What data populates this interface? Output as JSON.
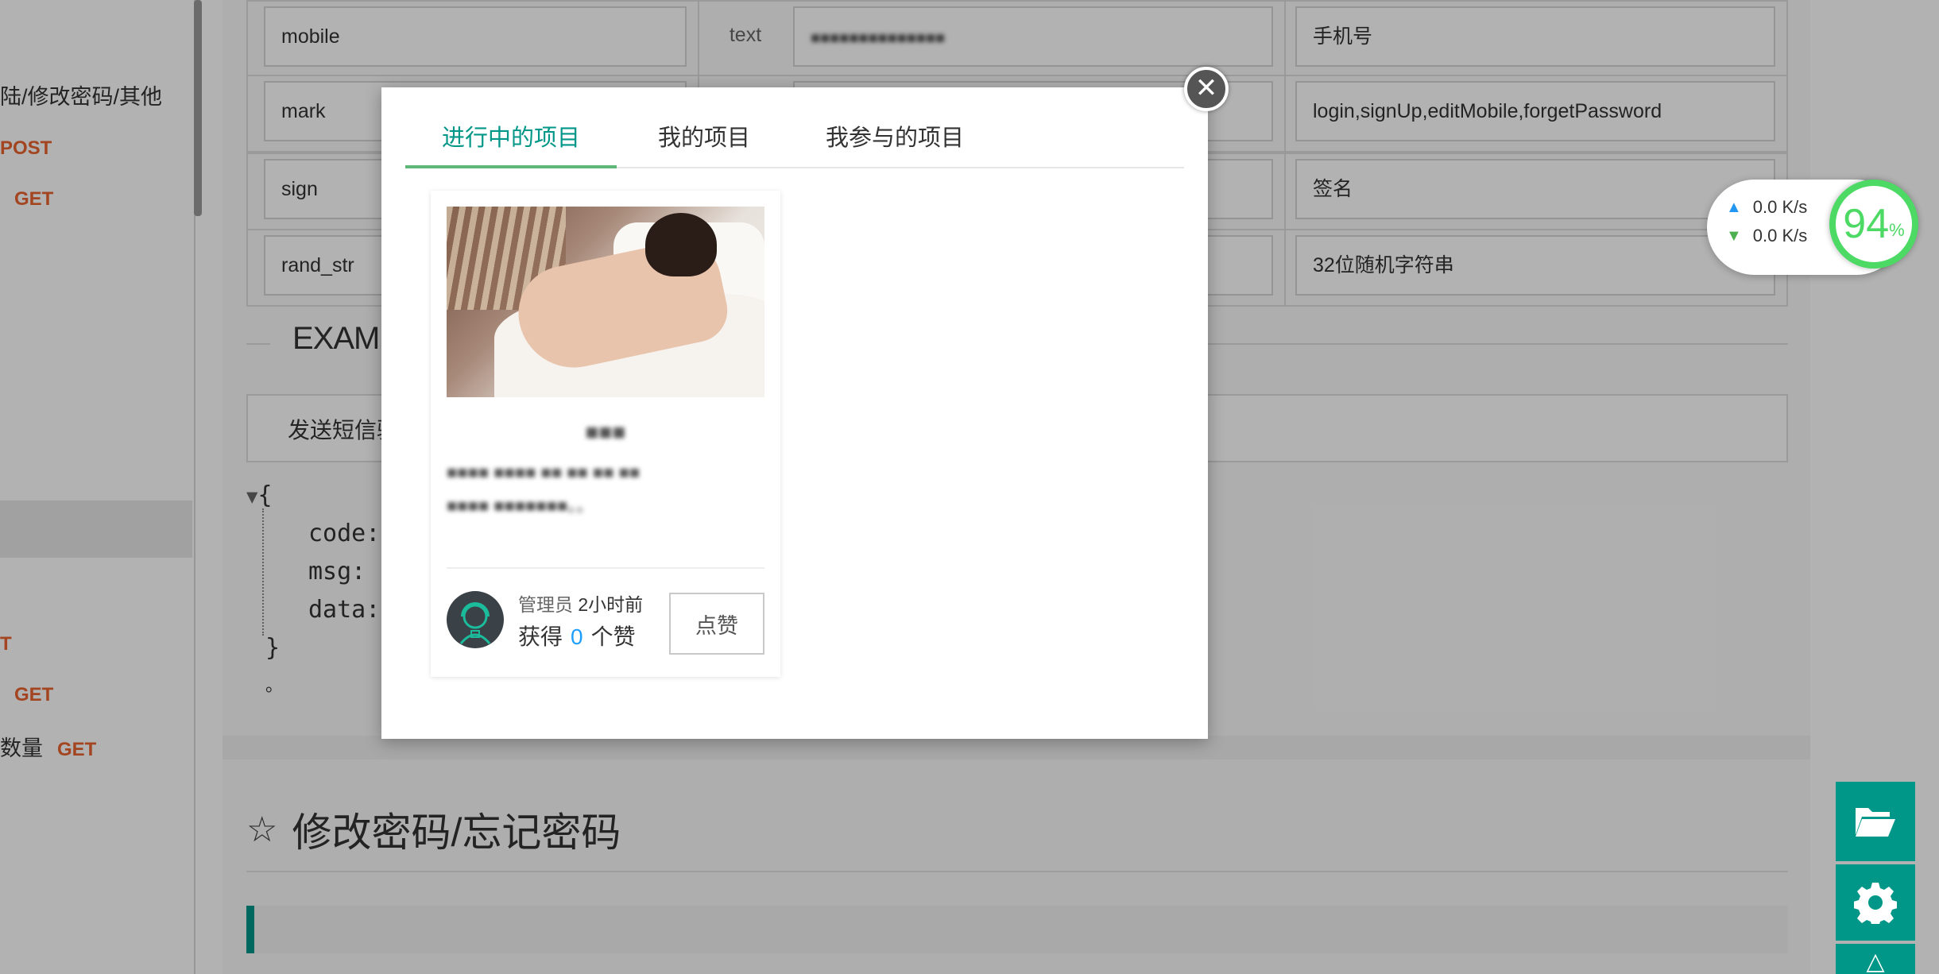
{
  "sidebar": {
    "items": [
      {
        "label": "陆/修改密码/其他",
        "method": ""
      },
      {
        "label": "",
        "method": "POST"
      },
      {
        "label": "",
        "method": "GET"
      },
      {
        "label": "",
        "method": "T"
      },
      {
        "label": "",
        "method": "GET"
      },
      {
        "label": "数量",
        "method": "GET"
      }
    ]
  },
  "params": {
    "rows": [
      {
        "name": "mobile",
        "type": "text",
        "example": "",
        "desc": "手机号"
      },
      {
        "name": "mark",
        "type": "",
        "example": "",
        "desc": "login,signUp,editMobile,forgetPassword"
      },
      {
        "name": "sign",
        "type": "",
        "example": "",
        "desc": "签名"
      },
      {
        "name": "rand_str",
        "type": "",
        "example": "",
        "desc": "32位随机字符串"
      }
    ]
  },
  "example": {
    "heading": "EXAMP",
    "tab_label": "发送短信验",
    "code_open": "{",
    "code_keys": [
      "code:",
      "msg:",
      "data:"
    ],
    "code_close": "}",
    "footnote": "。"
  },
  "section2": {
    "title": "修改密码/忘记密码"
  },
  "speed": {
    "up": "0.0 K/s",
    "down": "0.0 K/s",
    "percent_value": "94",
    "percent_sign": "%"
  },
  "colors": {
    "accent": "#009688",
    "tab_active_underline": "#5fb878",
    "link_blue": "#1e9fff",
    "method_orange": "#e8632f",
    "gauge_green": "#4cd964"
  },
  "icons": {
    "close": "close-icon",
    "folder": "folder-open-icon",
    "settings": "gear-icon",
    "top": "arrow-up-icon",
    "star": "star-outline-icon"
  },
  "modal": {
    "tabs": [
      {
        "label": "进行中的项目",
        "active": true
      },
      {
        "label": "我的项目",
        "active": false
      },
      {
        "label": "我参与的项目",
        "active": false
      }
    ],
    "project": {
      "title": "■■■",
      "desc_line1": "■■■■ ■■■■ ■■ ■■ ■■ ■■",
      "desc_line2": "■■■■ ■■■■■■■。。",
      "author_role": "管理员",
      "time": "2小时前",
      "likes_prefix": "获得",
      "likes_count": "0",
      "likes_suffix": "个赞",
      "like_button": "点赞"
    }
  }
}
